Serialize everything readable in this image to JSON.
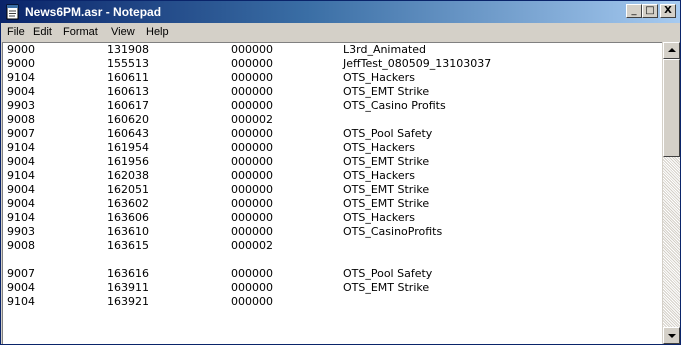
{
  "window": {
    "title": "News6PM.asr - Notepad",
    "controls": {
      "minimize": "_",
      "maximize": "□",
      "close": "X"
    }
  },
  "menu": [
    "File",
    "Edit",
    "Format",
    "View",
    "Help"
  ],
  "lines": [
    [
      "9000",
      "131908",
      "000000",
      "L3rd_Animated"
    ],
    [
      "9000",
      "155513",
      "000000",
      "JeffTest_080509_13103037"
    ],
    [
      "9104",
      "160611",
      "000000",
      "OTS_Hackers"
    ],
    [
      "9004",
      "160613",
      "000000",
      "OTS_EMT Strike"
    ],
    [
      "9903",
      "160617",
      "000000",
      "OTS_Casino Profits"
    ],
    [
      "9008",
      "160620",
      "000002",
      ""
    ],
    [
      "9007",
      "160643",
      "000000",
      "OTS_Pool Safety"
    ],
    [
      "9104",
      "161954",
      "000000",
      "OTS_Hackers"
    ],
    [
      "9004",
      "161956",
      "000000",
      "OTS_EMT Strike"
    ],
    [
      "9104",
      "162038",
      "000000",
      "OTS_Hackers"
    ],
    [
      "9004",
      "162051",
      "000000",
      "OTS_EMT Strike"
    ],
    [
      "9004",
      "163602",
      "000000",
      "OTS_EMT Strike"
    ],
    [
      "9104",
      "163606",
      "000000",
      "OTS_Hackers"
    ],
    [
      "9903",
      "163610",
      "000000",
      "OTS_CasinoProfits"
    ],
    [
      "9008",
      "163615",
      "000002",
      ""
    ],
    null,
    [
      "9007",
      "163616",
      "000000",
      "OTS_Pool Safety"
    ],
    [
      "9004",
      "163911",
      "000000",
      "OTS_EMT Strike"
    ],
    [
      "9104",
      "163921",
      "000000",
      ""
    ]
  ],
  "colors": {
    "titlebar_start": "#0a246a",
    "titlebar_end": "#a6caf0",
    "chrome": "#d4d0c8"
  },
  "icons": {
    "app": "notepad-icon",
    "scroll_up": "arrow-up-icon",
    "scroll_down": "arrow-down-icon"
  }
}
